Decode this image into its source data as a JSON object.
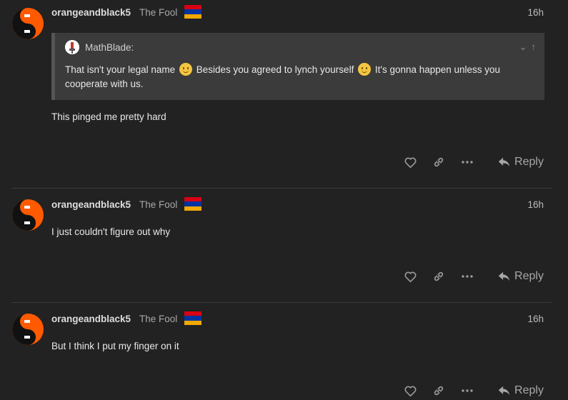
{
  "posts": [
    {
      "author": "orangeandblack5",
      "user_title": "The Fool",
      "time": "16h",
      "quote": {
        "author": "MathBlade:",
        "text_parts": [
          "That isn't your legal name",
          "Besides you agreed to lynch yourself",
          "It's gonna happen unless you cooperate with us."
        ]
      },
      "body": "This pinged me pretty hard",
      "reply_label": "Reply"
    },
    {
      "author": "orangeandblack5",
      "user_title": "The Fool",
      "time": "16h",
      "body": "I just couldn't figure out why",
      "reply_label": "Reply"
    },
    {
      "author": "orangeandblack5",
      "user_title": "The Fool",
      "time": "16h",
      "body": "But I think I put my finger on it",
      "reply_label": "Reply"
    }
  ],
  "colors": {
    "background": "#222222",
    "flag_red": "#d90012",
    "flag_blue": "#0033a0",
    "flag_orange": "#f2a800",
    "avatar_orange": "#ff5a00"
  }
}
